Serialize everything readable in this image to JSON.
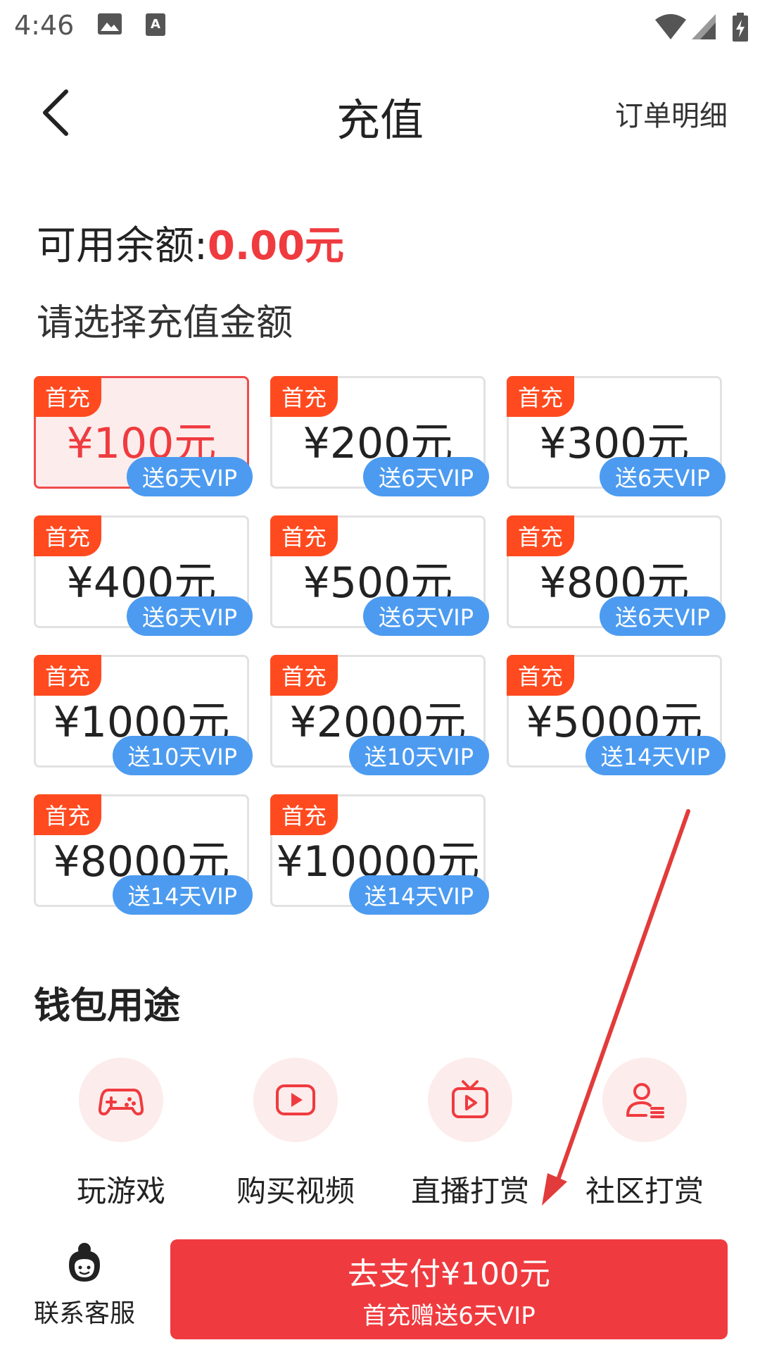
{
  "status_bar": {
    "time": "4:46"
  },
  "header": {
    "title": "充值",
    "orders_link": "订单明细"
  },
  "balance": {
    "label": "可用余额:",
    "amount": "0.00元"
  },
  "choose_label": "请选择充值金额",
  "packages": [
    {
      "badge": "首充",
      "amount": "¥100元",
      "bonus": "送6天VIP",
      "selected": true
    },
    {
      "badge": "首充",
      "amount": "¥200元",
      "bonus": "送6天VIP",
      "selected": false
    },
    {
      "badge": "首充",
      "amount": "¥300元",
      "bonus": "送6天VIP",
      "selected": false
    },
    {
      "badge": "首充",
      "amount": "¥400元",
      "bonus": "送6天VIP",
      "selected": false
    },
    {
      "badge": "首充",
      "amount": "¥500元",
      "bonus": "送6天VIP",
      "selected": false
    },
    {
      "badge": "首充",
      "amount": "¥800元",
      "bonus": "送6天VIP",
      "selected": false
    },
    {
      "badge": "首充",
      "amount": "¥1000元",
      "bonus": "送10天VIP",
      "selected": false
    },
    {
      "badge": "首充",
      "amount": "¥2000元",
      "bonus": "送10天VIP",
      "selected": false
    },
    {
      "badge": "首充",
      "amount": "¥5000元",
      "bonus": "送14天VIP",
      "selected": false
    },
    {
      "badge": "首充",
      "amount": "¥8000元",
      "bonus": "送14天VIP",
      "selected": false
    },
    {
      "badge": "首充",
      "amount": "¥10000元",
      "bonus": "送14天VIP",
      "selected": false
    }
  ],
  "wallet": {
    "title": "钱包用途",
    "uses": [
      {
        "label": "玩游戏",
        "icon": "gamepad-icon"
      },
      {
        "label": "购买视频",
        "icon": "video-play-icon"
      },
      {
        "label": "直播打赏",
        "icon": "tv-live-icon"
      },
      {
        "label": "社区打赏",
        "icon": "community-user-icon"
      }
    ]
  },
  "footer": {
    "service_label": "联系客服",
    "pay_main": "去支付¥100元",
    "pay_sub": "首充赠送6天VIP"
  },
  "colors": {
    "accent_red": "#ef3b3f",
    "badge_orange": "#ff4a1f",
    "vip_blue": "#4c9bf0",
    "selected_bg": "#fdecec"
  }
}
